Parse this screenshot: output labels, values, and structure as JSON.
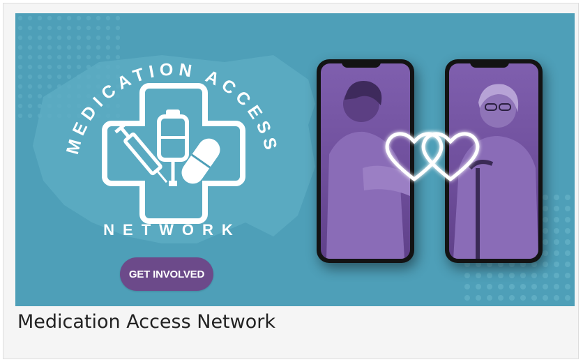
{
  "banner": {
    "ring_top_text": "MEDICATION ACCESS",
    "ring_bottom_text": "NETWORK",
    "cta_label": "GET INVOLVED"
  },
  "card": {
    "title": "Medication Access Network"
  },
  "colors": {
    "banner_bg": "#4e9fb8",
    "cta_bg": "#6c4a8a",
    "screen_tint": "#7f5fae"
  },
  "icons": [
    "medical-cross-icon",
    "syringe-icon",
    "iv-bag-icon",
    "pill-capsule-icon",
    "heart-icon"
  ]
}
